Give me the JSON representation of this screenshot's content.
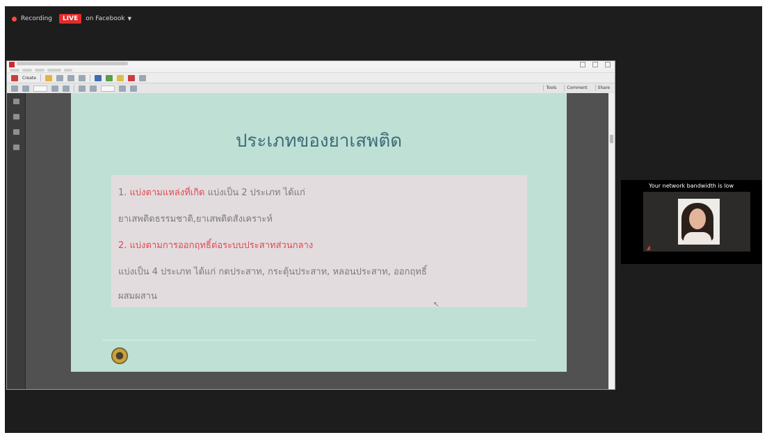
{
  "recording": {
    "label": "Recording",
    "live_label": "LIVE",
    "platform_label": "on Facebook",
    "dropdown_icon": "chevron-down-icon",
    "dot_color": "#ff4a3d",
    "live_color": "#e32a2a"
  },
  "viewer": {
    "toolbar": {
      "create_label": "Create",
      "right_panel_tools": "Tools",
      "right_panel_comment": "Comment",
      "right_panel_share": "Share"
    }
  },
  "slide": {
    "title": "ประเภทของยาเสพติด",
    "lines": {
      "l1_prefix": "1. ",
      "l1_highlight": "แบ่งตามแหล่งที่เกิด",
      "l1_rest": " แบ่งเป็น 2 ประเภท ได้แก่",
      "l2": "ยาเสพติดธรรมชาติ,ยาเสพติดสังเคราะห์",
      "l3": "2. แบ่งตามการออกฤทธิ์ต่อระบบประสาทส่วนกลาง",
      "l4": "แบ่งเป็น 4 ประเภท ได้แก่ กดประสาท, กระตุ้นประสาท, หลอนประสาท, ออกฤทธิ์",
      "l5": "ผสมผสาน"
    },
    "footer_left_1": "",
    "footer_left_2": "",
    "footer_right_1": "",
    "footer_right_2": "",
    "colors": {
      "background": "#bfe0d5",
      "title": "#3e6b78",
      "highlight": "#e2474d",
      "box": "#e2dcdf"
    }
  },
  "participant": {
    "bandwidth_warning": "Your network bandwidth is low",
    "name": "",
    "signal_icon": "weak-signal-icon"
  }
}
